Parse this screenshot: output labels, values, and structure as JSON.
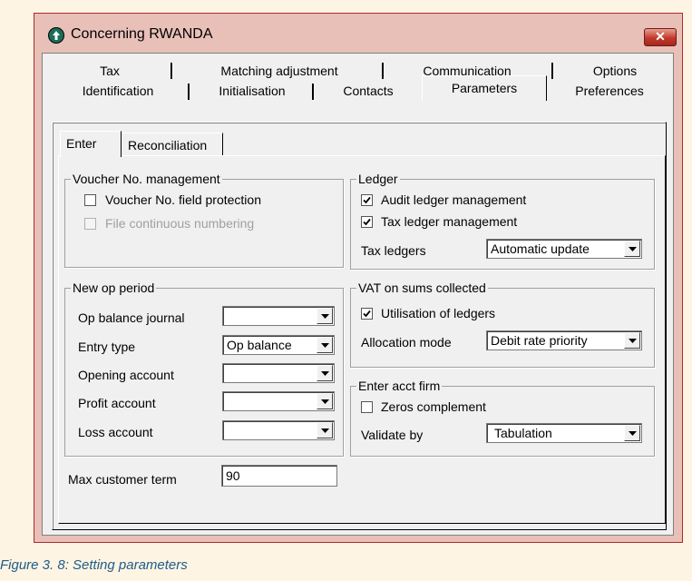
{
  "window": {
    "title": "Concerning RWANDA",
    "close_glyph": "✕"
  },
  "tabs_row1": [
    "Tax",
    "Matching adjustment",
    "Communication",
    "Options"
  ],
  "tabs_row2": [
    "Identification",
    "Initialisation",
    "Contacts",
    "Parameters",
    "Preferences"
  ],
  "active_tab": "Parameters",
  "subtabs": [
    "Enter",
    "Reconciliation"
  ],
  "active_subtab": "Enter",
  "voucher_group": {
    "legend": "Voucher No. management",
    "field_protection": {
      "label": "Voucher No. field protection",
      "checked": false
    },
    "continuous_numbering": {
      "label": "File continuous numbering",
      "checked": false,
      "disabled": true
    }
  },
  "ledger_group": {
    "legend": "Ledger",
    "audit": {
      "label": "Audit ledger management",
      "checked": true
    },
    "tax": {
      "label": "Tax ledger management",
      "checked": true
    },
    "tax_ledgers_label": "Tax ledgers",
    "tax_ledgers_value": "Automatic update"
  },
  "new_op_group": {
    "legend": "New op period",
    "op_balance_journal": {
      "label": "Op balance journal",
      "value": ""
    },
    "entry_type": {
      "label": "Entry type",
      "value": "Op balance"
    },
    "opening_account": {
      "label": "Opening account",
      "value": ""
    },
    "profit_account": {
      "label": "Profit account",
      "value": ""
    },
    "loss_account": {
      "label": "Loss account",
      "value": ""
    }
  },
  "vat_group": {
    "legend": "VAT on sums collected",
    "utilisation": {
      "label": "Utilisation of ledgers",
      "checked": true
    },
    "allocation_label": "Allocation mode",
    "allocation_value": "Debit rate priority"
  },
  "acct_firm_group": {
    "legend": "Enter acct firm",
    "zeros": {
      "label": "Zeros complement",
      "checked": false
    },
    "validate_label": "Validate by",
    "validate_value": "Tabulation"
  },
  "max_customer_term": {
    "label": "Max customer term",
    "value": "90"
  },
  "caption": "Figure 3. 8: Setting parameters",
  "colors": {
    "title_bg": "#e8c0b8",
    "close": "#c0392b",
    "caption": "#1f5c8a",
    "app_icon": "#1b6d5a"
  },
  "icons": {
    "app": "info-arrow-icon",
    "close": "close-icon",
    "dropdown": "chevron-down-icon",
    "check": "checkmark-icon"
  }
}
